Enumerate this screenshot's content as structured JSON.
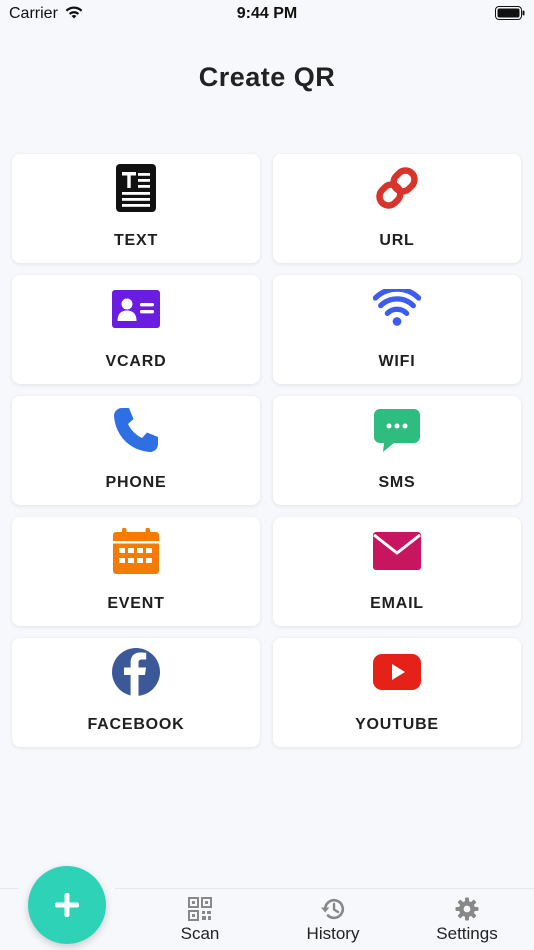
{
  "status_bar": {
    "carrier": "Carrier",
    "time": "9:44 PM"
  },
  "page_title": "Create QR",
  "cards": [
    {
      "label": "TEXT",
      "icon": "text-document-icon",
      "color": "#111111"
    },
    {
      "label": "URL",
      "icon": "link-icon",
      "color": "#d9342b"
    },
    {
      "label": "VCARD",
      "icon": "contact-card-icon",
      "color": "#6a1de0"
    },
    {
      "label": "WIFI",
      "icon": "wifi-icon",
      "color": "#3d5af1"
    },
    {
      "label": "PHONE",
      "icon": "phone-icon",
      "color": "#2f6fe4"
    },
    {
      "label": "SMS",
      "icon": "chat-bubble-icon",
      "color": "#2ebd7e"
    },
    {
      "label": "EVENT",
      "icon": "calendar-icon",
      "color": "#f57c00"
    },
    {
      "label": "EMAIL",
      "icon": "envelope-icon",
      "color": "#c8155f"
    },
    {
      "label": "FACEBOOK",
      "icon": "facebook-icon",
      "color": "#3b5998"
    },
    {
      "label": "YOUTUBE",
      "icon": "youtube-icon",
      "color": "#e62117"
    }
  ],
  "tabbar": {
    "fab_icon": "plus-icon",
    "fab_color": "#2ed3b7",
    "tabs": [
      {
        "label": "Scan",
        "icon": "qr-scan-icon"
      },
      {
        "label": "History",
        "icon": "history-icon"
      },
      {
        "label": "Settings",
        "icon": "gear-icon"
      }
    ]
  }
}
